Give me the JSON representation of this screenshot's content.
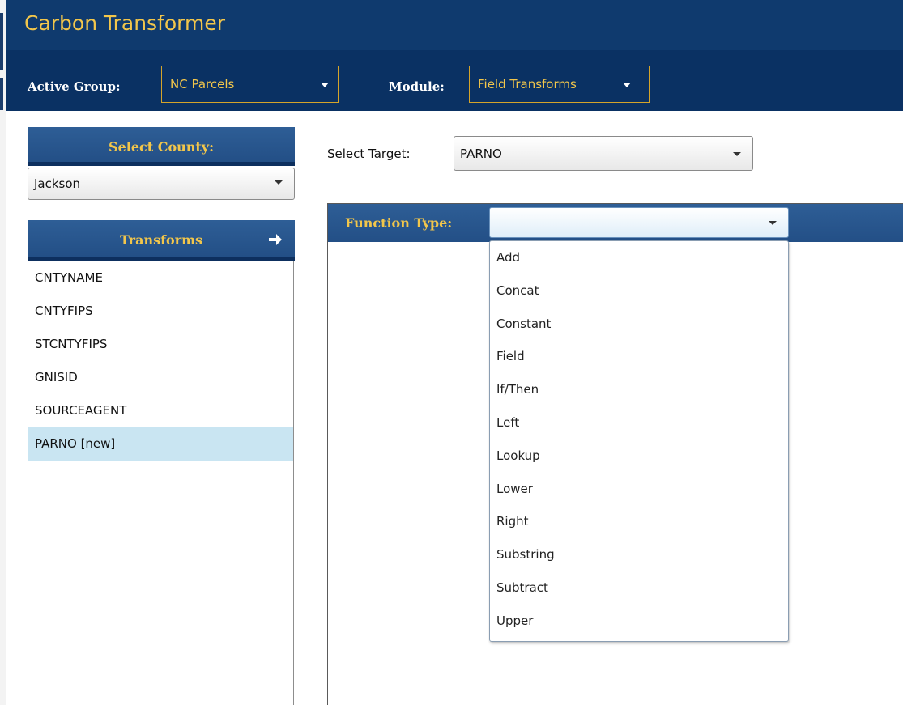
{
  "app": {
    "title": "Carbon Transformer"
  },
  "nav": {
    "active_group_label": "Active Group:",
    "active_group_value": "NC Parcels",
    "module_label": "Module:",
    "module_value": "Field Transforms"
  },
  "county": {
    "header": "Select County:",
    "value": "Jackson"
  },
  "transforms": {
    "header": "Transforms",
    "items": [
      "CNTYNAME",
      "CNTYFIPS",
      "STCNTYFIPS",
      "GNISID",
      "SOURCEAGENT",
      "PARNO [new]"
    ],
    "selected_index": 5
  },
  "target": {
    "label": "Select Target:",
    "value": "PARNO"
  },
  "function_type": {
    "label": "Function Type:",
    "value": "",
    "options": [
      "Add",
      "Concat",
      "Constant",
      "Field",
      "If/Then",
      "Left",
      "Lookup",
      "Lower",
      "Right",
      "Substring",
      "Subtract",
      "Upper"
    ]
  },
  "colors": {
    "title_bg": "#0f3a6e",
    "nav_bg": "#0a3163",
    "accent_gold": "#f2c64b",
    "panel_header": "#2a578f",
    "selected_row": "#c9e5f2"
  }
}
